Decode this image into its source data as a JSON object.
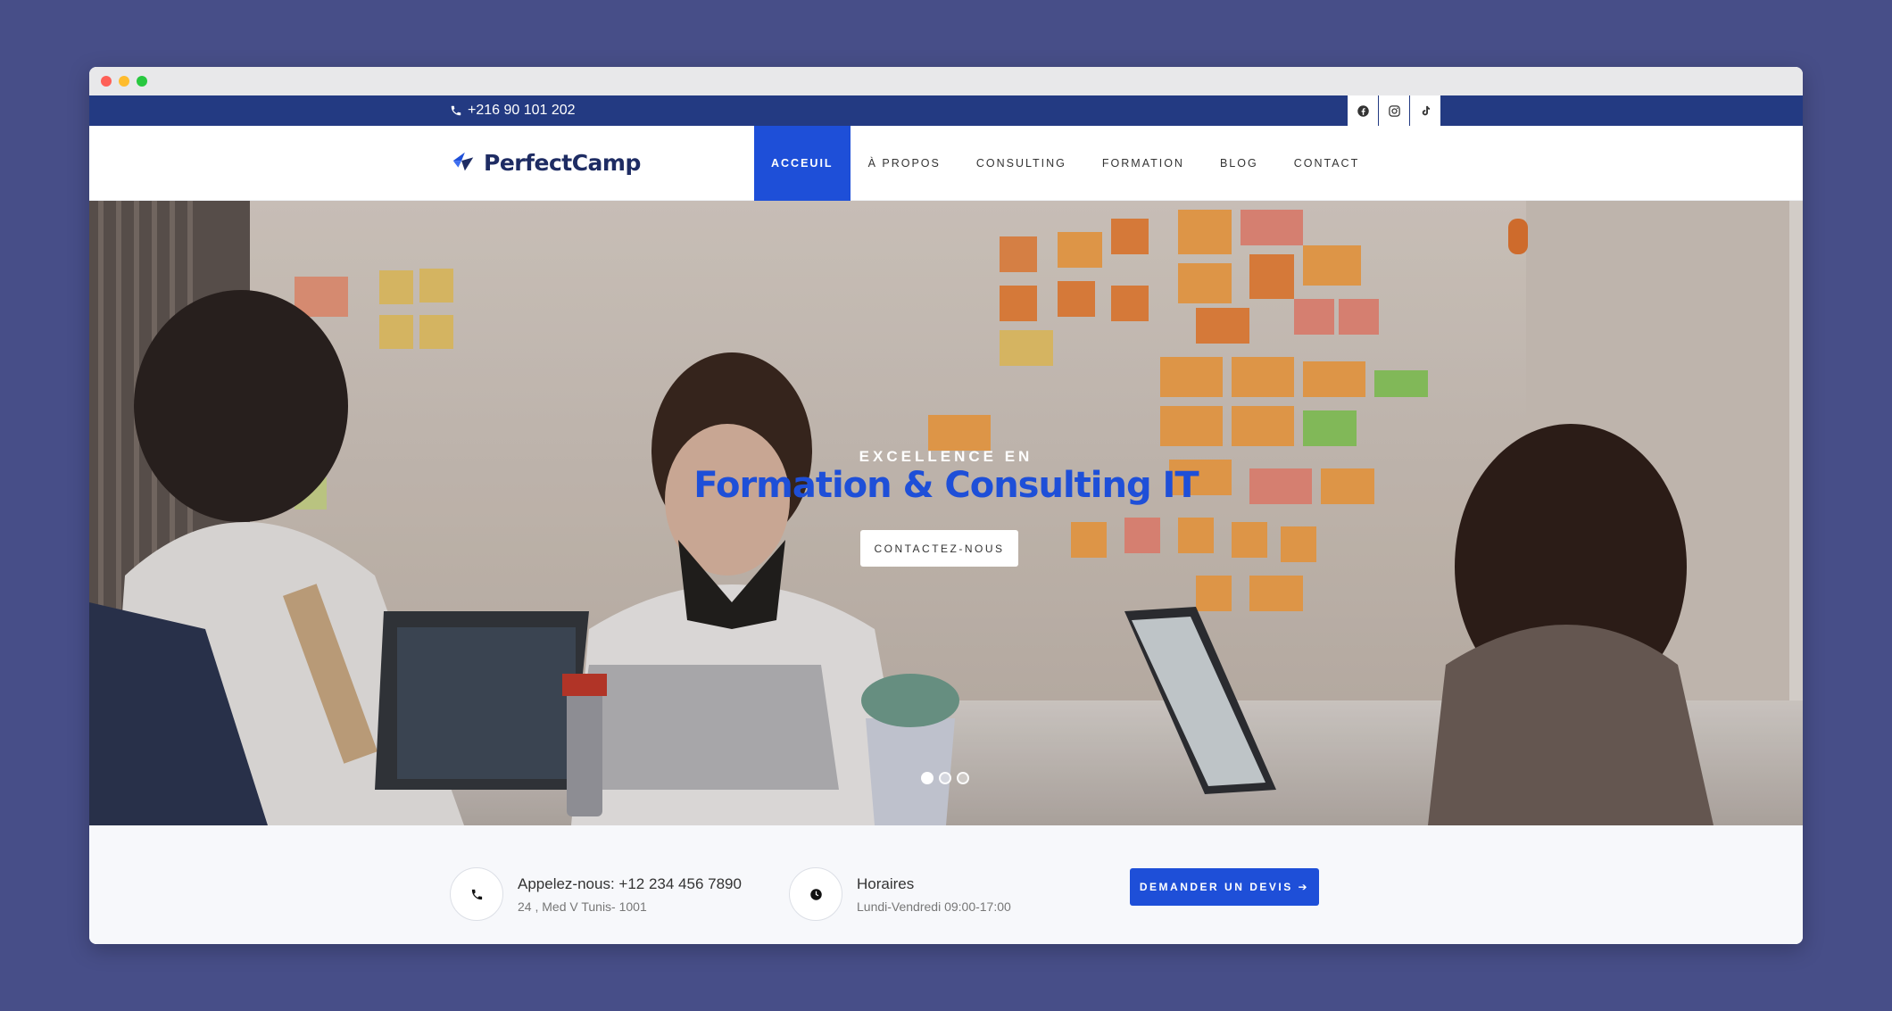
{
  "window": {
    "controls": [
      "close",
      "minimize",
      "maximize"
    ]
  },
  "topbar": {
    "phone_icon": "phone-icon",
    "phone": "+216 90 101 202",
    "socials": [
      {
        "name": "facebook-icon"
      },
      {
        "name": "instagram-icon"
      },
      {
        "name": "tiktok-icon"
      }
    ]
  },
  "brand": {
    "name": "PerfectCamp",
    "accent": "#1e4fd8",
    "navy": "#233a82"
  },
  "nav": {
    "items": [
      {
        "label": "ACCEUIL",
        "active": true
      },
      {
        "label": "À PROPOS"
      },
      {
        "label": "CONSULTING"
      },
      {
        "label": "FORMATION"
      },
      {
        "label": "BLOG"
      },
      {
        "label": "CONTACT"
      }
    ]
  },
  "hero": {
    "kicker": "EXCELLENCE EN",
    "headline": "Formation & Consulting IT",
    "button": "CONTACTEZ-NOUS",
    "slides": 3,
    "active_slide": 1
  },
  "info": {
    "call_title": "Appelez-nous: +12 234 456 7890",
    "address": "24 , Med V Tunis- 1001",
    "hours_title": "Horaires",
    "hours": "Lundi-Vendredi 09:00-17:00",
    "quote_button": "DEMANDER UN DEVIS ➔"
  }
}
